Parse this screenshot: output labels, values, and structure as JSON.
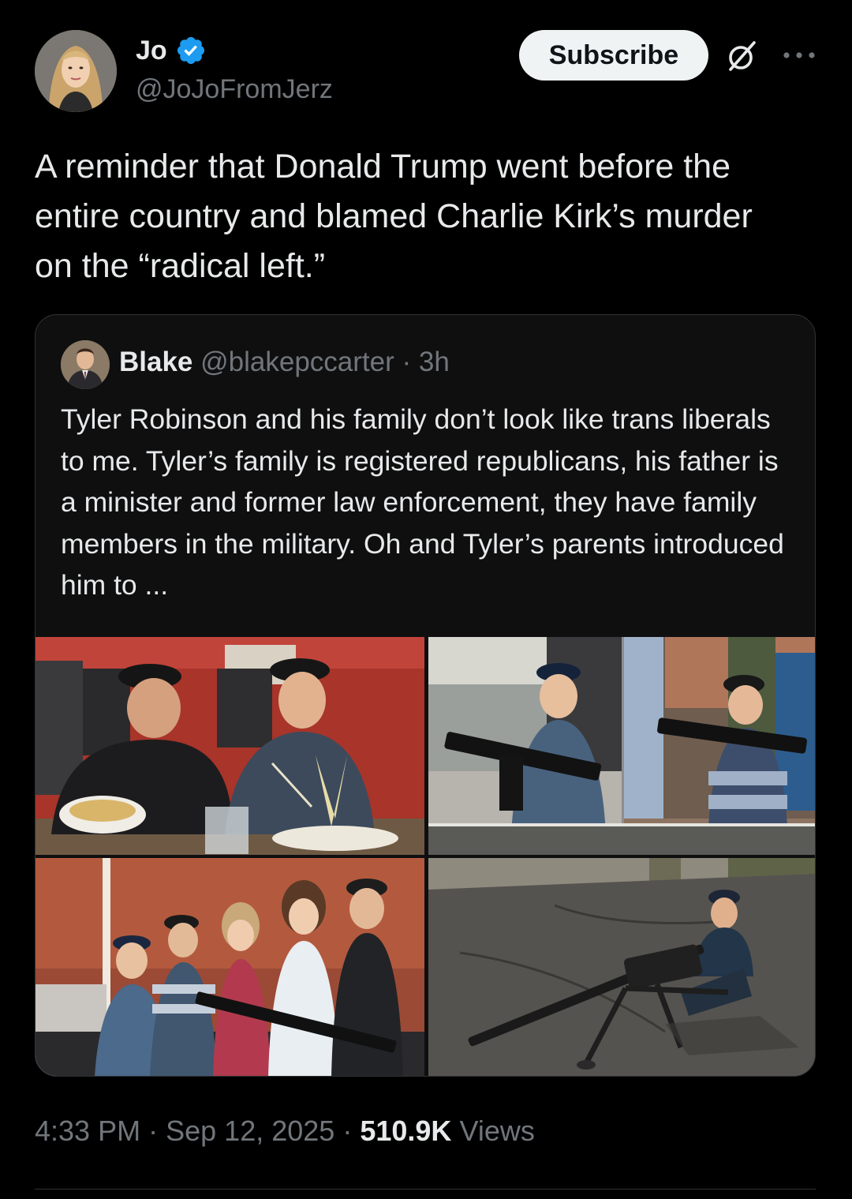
{
  "author": {
    "name": "Jo",
    "handle": "@JoJoFromJerz",
    "verified": true
  },
  "header": {
    "subscribe_label": "Subscribe",
    "grok_icon": "grok-icon",
    "more_icon": "more-options-icon"
  },
  "tweet": {
    "text": "A reminder that Donald Trump went before the\nentire country and blamed Charlie Kirk’s murder\non the “radical left.”"
  },
  "quote": {
    "name": "Blake",
    "handle": "@blakepccarter",
    "separator": "·",
    "time": "3h",
    "text": "Tyler Robinson and his family don’t look like trans liberals to me. Tyler’s family is registered republicans, his father is a minister and former law enforcement, they have family members in the military. Oh and Tyler’s parents introduced him to ...",
    "media": [
      {
        "description": "man and teen at restaurant table"
      },
      {
        "description": "two boys holding rifles"
      },
      {
        "description": "family group with rifle"
      },
      {
        "description": "teen with machine gun on tarmac"
      }
    ]
  },
  "meta": {
    "time": "4:33 PM",
    "separator": "·",
    "date": "Sep 12, 2025",
    "views_count": "510.9K",
    "views_label": "Views"
  },
  "colors": {
    "background": "#000000",
    "text_primary": "#e7e9ea",
    "text_secondary": "#71767b",
    "verified_blue": "#1d9bf0",
    "border": "#2f3336"
  }
}
